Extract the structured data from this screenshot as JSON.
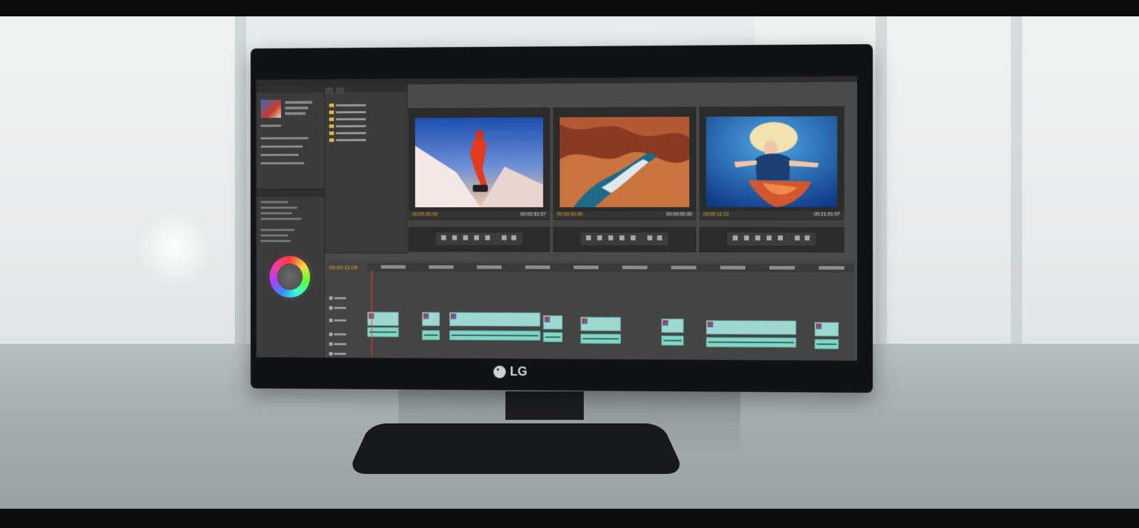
{
  "brand": {
    "logo_text": "LG"
  },
  "viewers": [
    {
      "timecode_in": "00:00:00:00",
      "timecode_out": "00:02:51:07",
      "image": "snowboarder-jump"
    },
    {
      "timecode_in": "00:00:00:00",
      "timecode_out": "00:00:00:00",
      "image": "canyon-aerial"
    },
    {
      "timecode_in": "00:00:11:22",
      "timecode_out": "00:21:01:07",
      "image": "underwater-dancer"
    }
  ],
  "timeline": {
    "current_timecode": "00:00:11:05"
  },
  "icons": {
    "logo": "lg-logo-icon",
    "folder": "folder-icon",
    "color_wheel": "color-wheel-icon",
    "play": "play-icon"
  },
  "colors": {
    "accent_timecode": "#e9a623",
    "clip_video": "#9fd8d0",
    "clip_audio": "#86d3c7",
    "playhead": "#ff3b3b",
    "folder": "#e3b93f"
  }
}
